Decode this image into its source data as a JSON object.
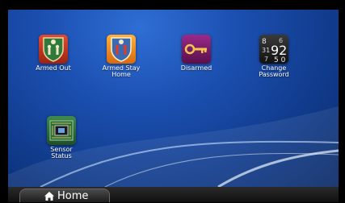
{
  "tiles": [
    {
      "label": "Armed Out",
      "icon": "armed-out-icon"
    },
    {
      "label": "Armed Stay Home",
      "icon": "armed-stay-home-icon"
    },
    {
      "label": "Disarmed",
      "icon": "disarmed-key-icon"
    },
    {
      "label": "Change Password",
      "icon": "change-password-icon"
    },
    {
      "label": "Sensor Status",
      "icon": "sensor-status-icon"
    }
  ],
  "taskbar": {
    "home_label": "Home",
    "home_icon": "home-icon"
  },
  "colors": {
    "panel_bg": "#1b4fb0",
    "armed_red": "#c23a2a",
    "armed_orange": "#f08a1a",
    "disarmed_purple": "#7a1f6a",
    "sensor_green": "#2e6a3a"
  }
}
